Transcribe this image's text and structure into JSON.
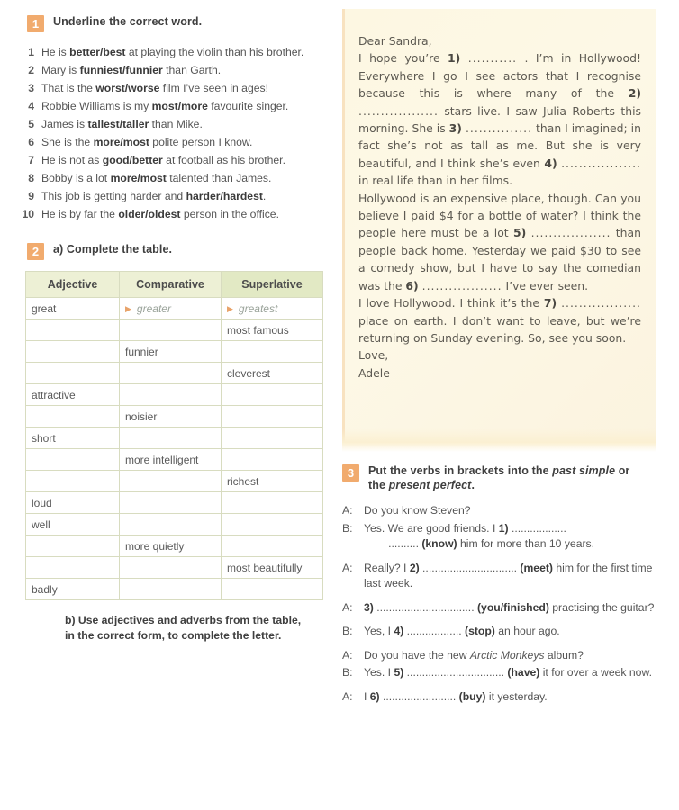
{
  "exercise1": {
    "number": "1",
    "title": "Underline the correct word.",
    "items": [
      {
        "n": "1",
        "html": "He is <b>better/best</b> at playing the violin than his brother."
      },
      {
        "n": "2",
        "html": "Mary is <b>funniest/funnier</b> than Garth."
      },
      {
        "n": "3",
        "html": "That is the <b>worst/worse</b> film I&rsquo;ve seen in ages!"
      },
      {
        "n": "4",
        "html": "Robbie Williams is my <b>most/more</b> favourite singer."
      },
      {
        "n": "5",
        "html": "James is <b>tallest/taller</b> than Mike."
      },
      {
        "n": "6",
        "html": "She is the <b>more/most</b> polite person I know."
      },
      {
        "n": "7",
        "html": "He is not as <b>good/better</b> at football as his brother."
      },
      {
        "n": "8",
        "html": "Bobby is a lot <b>more/most</b> talented than James."
      },
      {
        "n": "9",
        "html": "This job is getting harder and <b>harder/hardest</b>."
      },
      {
        "n": "10",
        "html": "He is by far the <b>older/oldest</b> person in the office."
      }
    ]
  },
  "exercise2": {
    "number": "2",
    "title_a": "a) Complete the table.",
    "title_b": "b) Use adjectives and adverbs from the table, in the correct form, to complete the letter.",
    "table": {
      "headers": [
        "Adjective",
        "Comparative",
        "Superlative"
      ],
      "rows": [
        {
          "adjective": "great",
          "comparative": "greater",
          "superlative": "greatest",
          "example": true
        },
        {
          "adjective": "",
          "comparative": "",
          "superlative": "most famous"
        },
        {
          "adjective": "",
          "comparative": "funnier",
          "superlative": ""
        },
        {
          "adjective": "",
          "comparative": "",
          "superlative": "cleverest"
        },
        {
          "adjective": "attractive",
          "comparative": "",
          "superlative": ""
        },
        {
          "adjective": "",
          "comparative": "noisier",
          "superlative": ""
        },
        {
          "adjective": "short",
          "comparative": "",
          "superlative": ""
        },
        {
          "adjective": "",
          "comparative": "more intelligent",
          "superlative": ""
        },
        {
          "adjective": "",
          "comparative": "",
          "superlative": "richest"
        },
        {
          "adjective": "loud",
          "comparative": "",
          "superlative": ""
        },
        {
          "adjective": "well",
          "comparative": "",
          "superlative": ""
        },
        {
          "adjective": "",
          "comparative": "more quietly",
          "superlative": ""
        },
        {
          "adjective": "",
          "comparative": "",
          "superlative": "most beautifully"
        },
        {
          "adjective": "badly",
          "comparative": "",
          "superlative": ""
        }
      ]
    }
  },
  "letter": {
    "paragraphs": [
      {
        "html": "Dear Sandra,",
        "justify": false
      },
      {
        "html": "I hope you&rsquo;re <span class=\"bold\">1)</span> <span class=\"dots\">...........</span> . I&rsquo;m in Hollywood! Everywhere I go I see actors that I recognise because this is where many of the <span class=\"bold\">2)</span> <span class=\"dots\">..................</span> stars live. I saw Julia Roberts this morning. She is <span class=\"bold\">3)</span> <span class=\"dots\">...............</span> than I imagined; in fact she&rsquo;s not as tall as me. But she is very beautiful, and I think she&rsquo;s even <span class=\"bold\">4)</span> <span class=\"dots\">..................</span> in real life than in her films.",
        "justify": true
      },
      {
        "html": "Hollywood is an expensive place, though. Can you believe I paid $4 for a bottle of water? I think the people here must be a lot <span class=\"bold\">5)</span> <span class=\"dots\">..................</span> than people back home. Yesterday we paid $30 to see a comedy show, but I have to say the comedian was the <span class=\"bold\">6)</span> <span class=\"dots\">..................</span> I&rsquo;ve ever seen.",
        "justify": true
      },
      {
        "html": "I love Hollywood. I think it&rsquo;s the <span class=\"bold\">7)</span> <span class=\"dots\">..................</span> place on earth. I don&rsquo;t want to leave, but we&rsquo;re returning on Sunday evening. So, see you soon.",
        "justify": true
      },
      {
        "html": "Love,",
        "justify": false
      },
      {
        "html": "Adele",
        "justify": false
      }
    ]
  },
  "exercise3": {
    "number": "3",
    "title": "Put the verbs in brackets into the <i class=\"it\">past simple</i> or the <i class=\"it\">present perfect</i>.",
    "dialogue": [
      {
        "speaker": "A:",
        "html": "Do you know Steven?",
        "gap": false
      },
      {
        "speaker": "B:",
        "html": "Yes. We are good friends. I <b>1)</b> .................. <br>&nbsp;&nbsp;&nbsp;&nbsp;&nbsp;&nbsp;&nbsp;&nbsp;.......... <b>(know)</b> him for more than 10 years.",
        "gap": false
      },
      {
        "speaker": "A:",
        "html": "Really? I <b>2)</b> ............................... <b>(meet)</b> him for the first time last week.",
        "gap": true
      },
      {
        "speaker": "A:",
        "html": "<b>3)</b> ................................ <b>(you/finished)</b> practising the guitar?",
        "gap": true
      },
      {
        "speaker": "B:",
        "html": "Yes, I <b>4)</b> .................. <b>(stop)</b> an hour ago.",
        "gap": true
      },
      {
        "speaker": "A:",
        "html": "Do you have the new <i>Arctic Monkeys</i> album?",
        "gap": true
      },
      {
        "speaker": "B:",
        "html": "Yes. I <b>5)</b> ................................ <b>(have)</b> it for over a week now.",
        "gap": false
      },
      {
        "speaker": "A:",
        "html": "I <b>6)</b> ........................ <b>(buy)</b> it yesterday.",
        "gap": true
      }
    ]
  },
  "colors": {
    "badge": "#f1ab6e",
    "table_header": "#edf0d5",
    "table_header_superlative": "#e2e9c4",
    "table_border": "#d8dcc0",
    "letter_bg": "#fdf7e2",
    "example_text": "#9aa39a",
    "triangle": "#e8a36a"
  }
}
